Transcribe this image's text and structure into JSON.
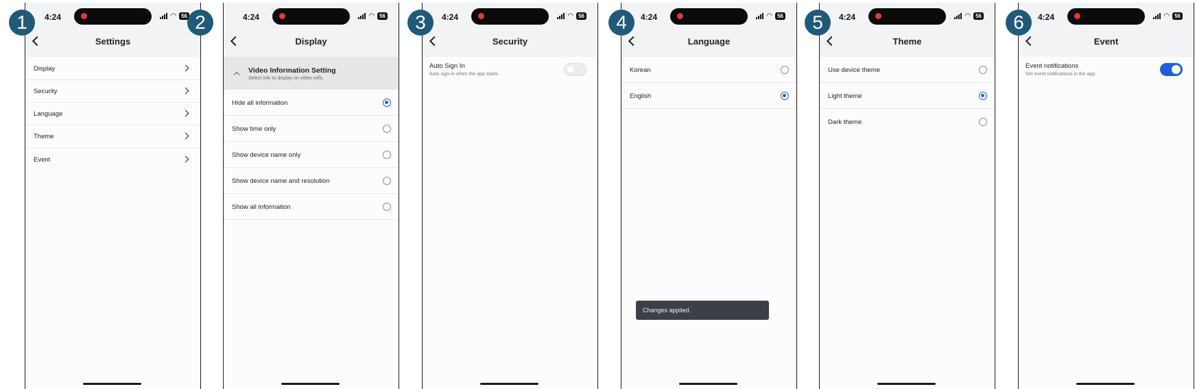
{
  "status_bar": {
    "time": "4:24",
    "battery": "56"
  },
  "panels": [
    {
      "badge": "1",
      "title": "Settings",
      "items": [
        {
          "label": "Display"
        },
        {
          "label": "Security"
        },
        {
          "label": "Language"
        },
        {
          "label": "Theme"
        },
        {
          "label": "Event"
        }
      ]
    },
    {
      "badge": "2",
      "title": "Display",
      "section": {
        "title": "Video Information Setting",
        "subtitle": "Select info to display on video cells."
      },
      "options": [
        {
          "label": "Hide all information",
          "selected": true
        },
        {
          "label": "Show time only",
          "selected": false
        },
        {
          "label": "Show device name only",
          "selected": false
        },
        {
          "label": "Show device name and resolution",
          "selected": false
        },
        {
          "label": "Show all information",
          "selected": false
        }
      ]
    },
    {
      "badge": "3",
      "title": "Security",
      "setting": {
        "title": "Auto Sign In",
        "subtitle": "Auto sign-in when the app starts.",
        "enabled": false
      }
    },
    {
      "badge": "4",
      "title": "Language",
      "options": [
        {
          "label": "Korean",
          "selected": false
        },
        {
          "label": "English",
          "selected": true
        }
      ],
      "toast": "Changes applied."
    },
    {
      "badge": "5",
      "title": "Theme",
      "options": [
        {
          "label": "Use device theme",
          "selected": false
        },
        {
          "label": "Light theme",
          "selected": true
        },
        {
          "label": "Dark theme",
          "selected": false
        }
      ]
    },
    {
      "badge": "6",
      "title": "Event",
      "setting": {
        "title": "Event notifications",
        "subtitle": "Set event notifications in the app.",
        "enabled": true
      }
    }
  ],
  "colors": {
    "accent": "#2362c9",
    "toggle_on": "#1d5fd6",
    "badge": "#1f5a7a",
    "header_bg": "#f2f3f5"
  }
}
